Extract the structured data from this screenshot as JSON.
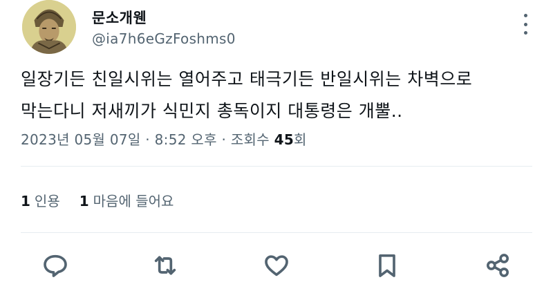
{
  "author": {
    "display_name": "문소개웬",
    "handle": "@ia7h6eGzFoshms0",
    "avatar_icon": "warrior-portrait-avatar"
  },
  "menu": {
    "icon": "more-vertical-icon"
  },
  "tweet": {
    "lines": [
      "일장기든 친일시위는 열어주고 태극기든 반일시위는 차벽으로",
      "막는다니  저새끼가 식민지 총독이지 대통령은 개뿔.."
    ]
  },
  "meta": {
    "date": "2023년 05월 07일",
    "sep1": "·",
    "time": "8:52 오후",
    "sep2": "·",
    "views_label": "조회수",
    "views_count": "45",
    "views_suffix": "회"
  },
  "stats": {
    "quotes_count": "1",
    "quotes_label": "인용",
    "likes_count": "1",
    "likes_label": "마음에 들어요"
  },
  "actions": {
    "reply_icon": "reply-icon",
    "retweet_icon": "retweet-icon",
    "like_icon": "heart-icon",
    "bookmark_icon": "bookmark-icon",
    "share_icon": "share-icon"
  },
  "colors": {
    "text_primary": "#0f1419",
    "text_secondary": "#536471",
    "divider": "#e6ecf0"
  }
}
